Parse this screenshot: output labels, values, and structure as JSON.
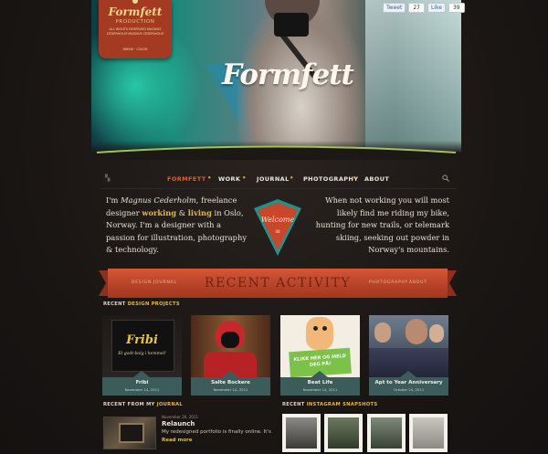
{
  "colors": {
    "accent_orange": "#e45b2d",
    "accent_gold": "#e3b84a",
    "banner_red": "#c9462a",
    "teal": "#3b5c5a",
    "background": "#1c1816"
  },
  "hero": {
    "logo": "Formfett"
  },
  "badge": {
    "title": "Formfett",
    "subtitle": "PRODUCTION",
    "lines": "ALL RIGHTS RESERVED MAGNUS CEDERHOLM MAGNUS CEDERHOLM",
    "footer": "MMVIII · COLOR"
  },
  "social": {
    "tweet_label": "Tweet",
    "tweet_count": "27",
    "like_label": "Like",
    "like_count": "39"
  },
  "nav": {
    "items": [
      {
        "label": "FORMFETT"
      },
      {
        "label": "WORK"
      },
      {
        "label": "JOURNAL"
      },
      {
        "label": "PHOTOGRAPHY"
      },
      {
        "label": "ABOUT"
      }
    ],
    "search_icon": "search-icon"
  },
  "intro": {
    "left_1": "I'm ",
    "name": "Magnus Cederholm",
    "left_2": ", freelance designer ",
    "working": "working",
    "amp": " & ",
    "living": "living",
    "left_3": " in Oslo, Norway. I'm a designer with a passion for illustration, photography & technology.",
    "right": "When not working you will most likely find me riding my bike, hunting for new trails, or telemark skiing, seeking out powder in Norway's mountains.",
    "welcome": "Welcome",
    "welcome_sub": "08"
  },
  "banner": {
    "title": "RECENT ACTIVITY",
    "left_links": [
      "DESIGN",
      "JOURNAL"
    ],
    "right_links": [
      "PHOTOGRAPHY",
      "ABOUT"
    ]
  },
  "projects": {
    "label_prefix": "RECENT ",
    "label_hl": "DESIGN PROJECTS",
    "items": [
      {
        "name": "Fribi",
        "date": "November 14, 2011",
        "thumb_text": "Fribi",
        "thumb_sub": "Et godt-bolg i hemmel!"
      },
      {
        "name": "Salte Bockere",
        "date": "November 14, 2011"
      },
      {
        "name": "Beat Life",
        "date": "November 14, 2011",
        "thumb_text": "KLIKK HER OG MELD DEG PÅ!"
      },
      {
        "name": "Apt to Year Anniversary",
        "date": "October 24, 2011"
      }
    ]
  },
  "journal": {
    "label_prefix": "RECENT FROM MY ",
    "label_hl": "JOURNAL",
    "date": "November 26, 2011",
    "title": "Relaunch",
    "text": "My redesigned portfolio is finally online. It's",
    "more": "Read more"
  },
  "instagram": {
    "label_prefix": "RECENT ",
    "label_hl": "INSTAGRAM SNAPSHOTS"
  }
}
